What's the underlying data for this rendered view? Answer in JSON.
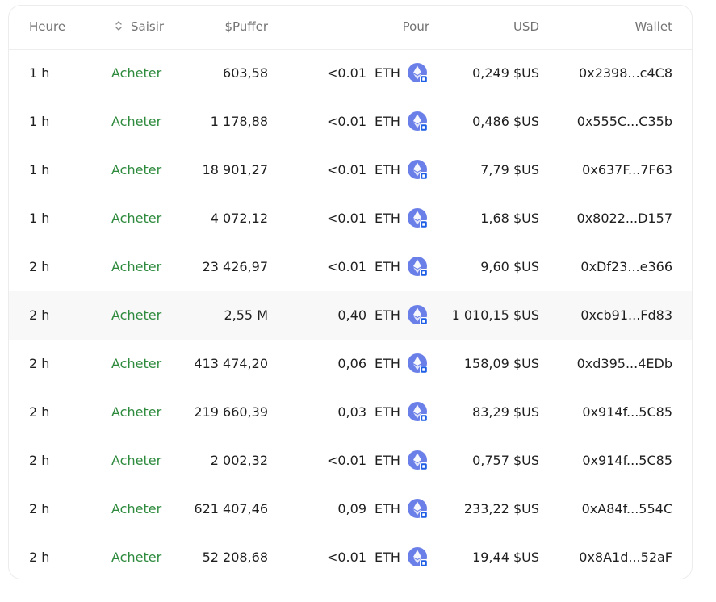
{
  "header": {
    "time": "Heure",
    "type": "Saisir",
    "amount": "$Puffer",
    "pour": "Pour",
    "usd": "USD",
    "wallet": "Wallet"
  },
  "rows": [
    {
      "time": "1 h",
      "type": "Acheter",
      "amount": "603,58",
      "pour": "<0.01",
      "sym": "ETH",
      "usd": "0,249 $US",
      "wallet": "0x2398...c4C8"
    },
    {
      "time": "1 h",
      "type": "Acheter",
      "amount": "1 178,88",
      "pour": "<0.01",
      "sym": "ETH",
      "usd": "0,486 $US",
      "wallet": "0x555C...C35b"
    },
    {
      "time": "1 h",
      "type": "Acheter",
      "amount": "18 901,27",
      "pour": "<0.01",
      "sym": "ETH",
      "usd": "7,79 $US",
      "wallet": "0x637F...7F63"
    },
    {
      "time": "1 h",
      "type": "Acheter",
      "amount": "4 072,12",
      "pour": "<0.01",
      "sym": "ETH",
      "usd": "1,68 $US",
      "wallet": "0x8022...D157"
    },
    {
      "time": "2 h",
      "type": "Acheter",
      "amount": "23 426,97",
      "pour": "<0.01",
      "sym": "ETH",
      "usd": "9,60 $US",
      "wallet": "0xDf23...e366"
    },
    {
      "time": "2 h",
      "type": "Acheter",
      "amount": "2,55 M",
      "pour": "0,40",
      "sym": "ETH",
      "usd": "1 010,15 $US",
      "wallet": "0xcb91...Fd83"
    },
    {
      "time": "2 h",
      "type": "Acheter",
      "amount": "413 474,20",
      "pour": "0,06",
      "sym": "ETH",
      "usd": "158,09 $US",
      "wallet": "0xd395...4EDb"
    },
    {
      "time": "2 h",
      "type": "Acheter",
      "amount": "219 660,39",
      "pour": "0,03",
      "sym": "ETH",
      "usd": "83,29 $US",
      "wallet": "0x914f...5C85"
    },
    {
      "time": "2 h",
      "type": "Acheter",
      "amount": "2 002,32",
      "pour": "<0.01",
      "sym": "ETH",
      "usd": "0,757 $US",
      "wallet": "0x914f...5C85"
    },
    {
      "time": "2 h",
      "type": "Acheter",
      "amount": "621 407,46",
      "pour": "0,09",
      "sym": "ETH",
      "usd": "233,22 $US",
      "wallet": "0xA84f...554C"
    },
    {
      "time": "2 h",
      "type": "Acheter",
      "amount": "52 208,68",
      "pour": "<0.01",
      "sym": "ETH",
      "usd": "19,44 $US",
      "wallet": "0x8A1d...52aF"
    }
  ],
  "colors": {
    "buy": "#2e8b3e",
    "header_text": "#737373",
    "eth_icon_bg": "#6a7fe8",
    "chain_badge": "#1f5fe6",
    "highlight_row": "#f8f8f8"
  },
  "icons": {
    "sort": "sort-updown-icon",
    "eth": "ethereum-icon",
    "chain_badge": "base-chain-badge-icon"
  }
}
